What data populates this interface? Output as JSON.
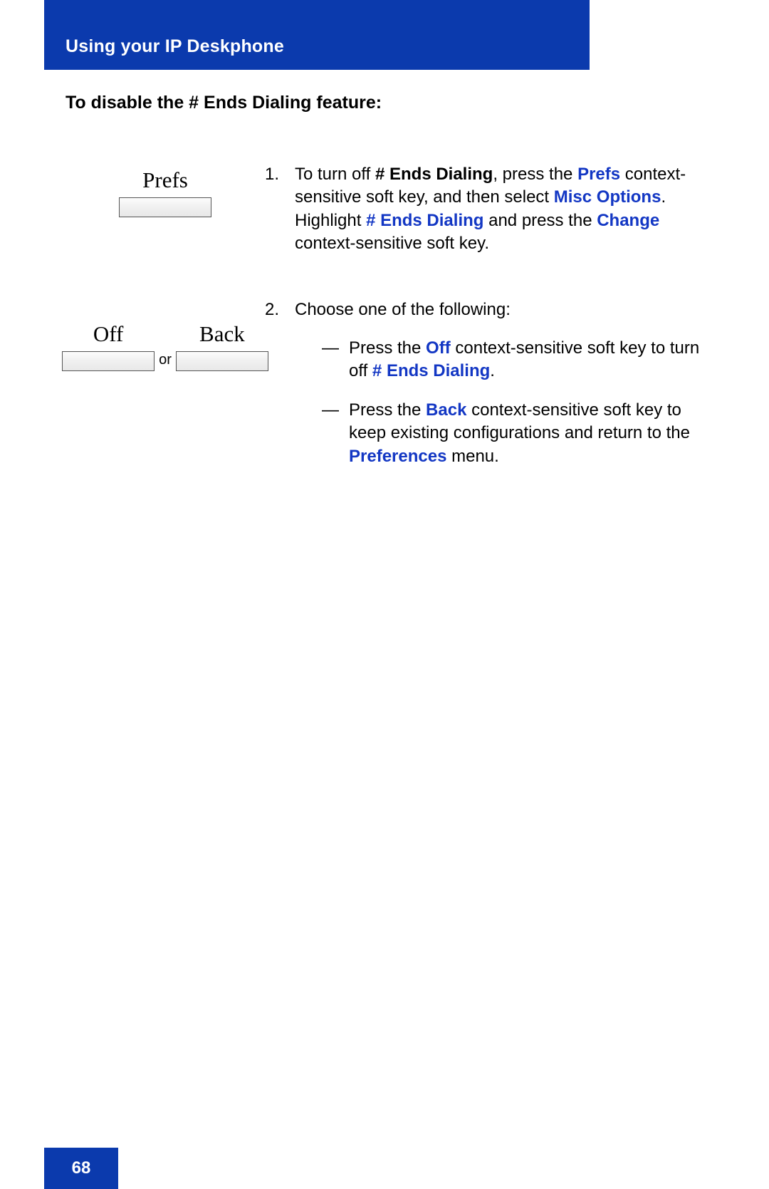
{
  "header": {
    "title": "Using your IP Deskphone"
  },
  "subtitle": "To disable the # Ends Dialing feature:",
  "softkeys": {
    "prefs": "Prefs",
    "off": "Off",
    "back": "Back",
    "or": "or"
  },
  "steps": {
    "s1": {
      "num": "1.",
      "t1": "To turn off ",
      "b1": "# Ends Dialing",
      "t2": ", press the ",
      "k1": "Prefs",
      "t3": " context-sensitive soft key, and then select ",
      "k2": "Misc Options",
      "t4": ". Highlight ",
      "k3": "# Ends Dialing",
      "t5": " and press the ",
      "k4": "Change",
      "t6": " context-sensitive soft key."
    },
    "s2": {
      "num": "2.",
      "intro": "Choose one of the following:",
      "a": {
        "t1": "Press the ",
        "k1": "Off",
        "t2": " context-sensitive soft key to turn off ",
        "k2": "# Ends Dialing",
        "t3": "."
      },
      "b": {
        "t1": "Press the ",
        "k1": "Back",
        "t2": " context-sensitive soft key to keep existing configurations and return to the ",
        "k2": "Preferences",
        "t3": " menu."
      }
    }
  },
  "dash": "—",
  "page_number": "68"
}
